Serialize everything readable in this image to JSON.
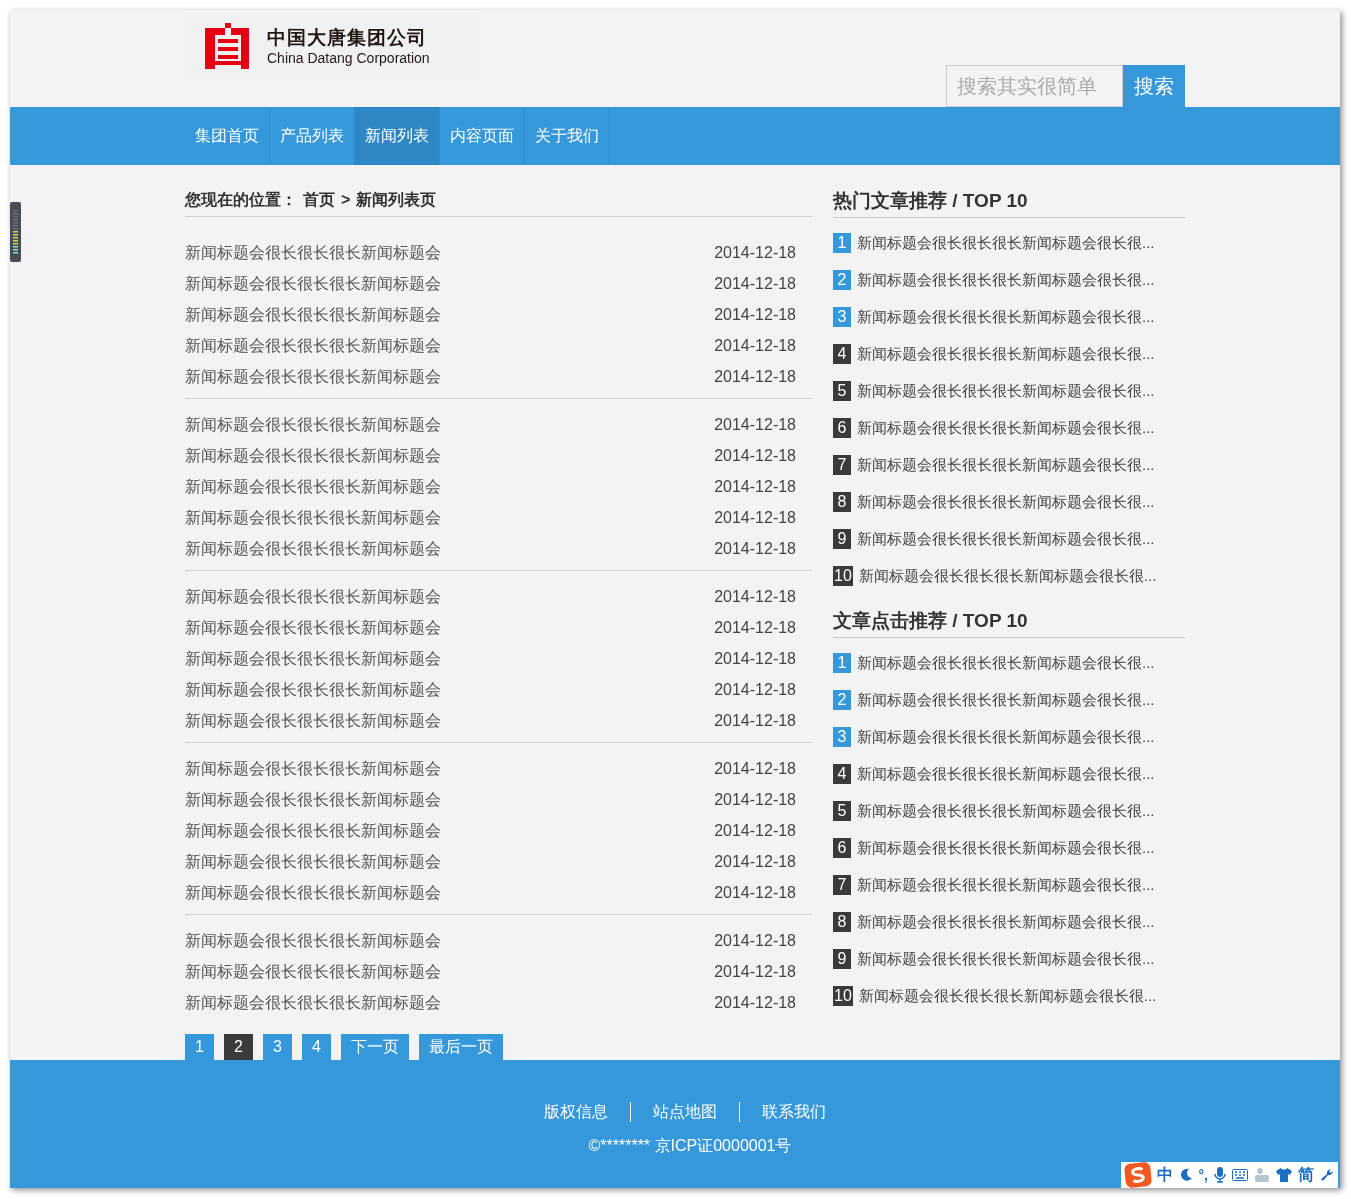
{
  "header": {
    "logo": {
      "name": "中国大唐集团公司",
      "subtitle": "China Datang Corporation"
    },
    "search": {
      "placeholder": "搜索其实很简单",
      "button": "搜索"
    }
  },
  "nav": [
    {
      "label": "集团首页",
      "selected": false
    },
    {
      "label": "产品列表",
      "selected": false
    },
    {
      "label": "新闻列表",
      "selected": true
    },
    {
      "label": "内容页面",
      "selected": false
    },
    {
      "label": "关于我们",
      "selected": false
    }
  ],
  "breadcrumb": {
    "label": "您现在的位置：",
    "items": [
      "首页",
      "新闻列表页"
    ],
    "separator": ">"
  },
  "news_groups": [
    [
      {
        "title": "新闻标题会很长很长很长新闻标题会",
        "date": "2014-12-18"
      },
      {
        "title": "新闻标题会很长很长很长新闻标题会",
        "date": "2014-12-18"
      },
      {
        "title": "新闻标题会很长很长很长新闻标题会",
        "date": "2014-12-18"
      },
      {
        "title": "新闻标题会很长很长很长新闻标题会",
        "date": "2014-12-18"
      },
      {
        "title": "新闻标题会很长很长很长新闻标题会",
        "date": "2014-12-18"
      }
    ],
    [
      {
        "title": "新闻标题会很长很长很长新闻标题会",
        "date": "2014-12-18"
      },
      {
        "title": "新闻标题会很长很长很长新闻标题会",
        "date": "2014-12-18"
      },
      {
        "title": "新闻标题会很长很长很长新闻标题会",
        "date": "2014-12-18"
      },
      {
        "title": "新闻标题会很长很长很长新闻标题会",
        "date": "2014-12-18"
      },
      {
        "title": "新闻标题会很长很长很长新闻标题会",
        "date": "2014-12-18"
      }
    ],
    [
      {
        "title": "新闻标题会很长很长很长新闻标题会",
        "date": "2014-12-18"
      },
      {
        "title": "新闻标题会很长很长很长新闻标题会",
        "date": "2014-12-18"
      },
      {
        "title": "新闻标题会很长很长很长新闻标题会",
        "date": "2014-12-18"
      },
      {
        "title": "新闻标题会很长很长很长新闻标题会",
        "date": "2014-12-18"
      },
      {
        "title": "新闻标题会很长很长很长新闻标题会",
        "date": "2014-12-18"
      }
    ],
    [
      {
        "title": "新闻标题会很长很长很长新闻标题会",
        "date": "2014-12-18"
      },
      {
        "title": "新闻标题会很长很长很长新闻标题会",
        "date": "2014-12-18"
      },
      {
        "title": "新闻标题会很长很长很长新闻标题会",
        "date": "2014-12-18"
      },
      {
        "title": "新闻标题会很长很长很长新闻标题会",
        "date": "2014-12-18"
      },
      {
        "title": "新闻标题会很长很长很长新闻标题会",
        "date": "2014-12-18"
      }
    ],
    [
      {
        "title": "新闻标题会很长很长很长新闻标题会",
        "date": "2014-12-18"
      },
      {
        "title": "新闻标题会很长很长很长新闻标题会",
        "date": "2014-12-18"
      },
      {
        "title": "新闻标题会很长很长很长新闻标题会",
        "date": "2014-12-18"
      }
    ]
  ],
  "pagination": [
    {
      "label": "1",
      "selected": false
    },
    {
      "label": "2",
      "selected": true
    },
    {
      "label": "3",
      "selected": false
    },
    {
      "label": "4",
      "selected": false
    },
    {
      "label": "下一页",
      "selected": false
    },
    {
      "label": "最后一页",
      "selected": false
    }
  ],
  "sidebar": [
    {
      "title": "热门文章推荐 / TOP 10",
      "items": [
        {
          "rank": "1",
          "title": "新闻标题会很长很长很长新闻标题会很长很...",
          "highlighted": true
        },
        {
          "rank": "2",
          "title": "新闻标题会很长很长很长新闻标题会很长很...",
          "highlighted": true
        },
        {
          "rank": "3",
          "title": "新闻标题会很长很长很长新闻标题会很长很...",
          "highlighted": true
        },
        {
          "rank": "4",
          "title": "新闻标题会很长很长很长新闻标题会很长很...",
          "highlighted": false
        },
        {
          "rank": "5",
          "title": "新闻标题会很长很长很长新闻标题会很长很...",
          "highlighted": false
        },
        {
          "rank": "6",
          "title": "新闻标题会很长很长很长新闻标题会很长很...",
          "highlighted": false
        },
        {
          "rank": "7",
          "title": "新闻标题会很长很长很长新闻标题会很长很...",
          "highlighted": false
        },
        {
          "rank": "8",
          "title": "新闻标题会很长很长很长新闻标题会很长很...",
          "highlighted": false
        },
        {
          "rank": "9",
          "title": "新闻标题会很长很长很长新闻标题会很长很...",
          "highlighted": false
        },
        {
          "rank": "10",
          "title": "新闻标题会很长很长很长新闻标题会很长很...",
          "highlighted": false
        }
      ]
    },
    {
      "title": "文章点击推荐 / TOP 10",
      "items": [
        {
          "rank": "1",
          "title": "新闻标题会很长很长很长新闻标题会很长很...",
          "highlighted": true
        },
        {
          "rank": "2",
          "title": "新闻标题会很长很长很长新闻标题会很长很...",
          "highlighted": true
        },
        {
          "rank": "3",
          "title": "新闻标题会很长很长很长新闻标题会很长很...",
          "highlighted": true
        },
        {
          "rank": "4",
          "title": "新闻标题会很长很长很长新闻标题会很长很...",
          "highlighted": false
        },
        {
          "rank": "5",
          "title": "新闻标题会很长很长很长新闻标题会很长很...",
          "highlighted": false
        },
        {
          "rank": "6",
          "title": "新闻标题会很长很长很长新闻标题会很长很...",
          "highlighted": false
        },
        {
          "rank": "7",
          "title": "新闻标题会很长很长很长新闻标题会很长很...",
          "highlighted": false
        },
        {
          "rank": "8",
          "title": "新闻标题会很长很长很长新闻标题会很长很...",
          "highlighted": false
        },
        {
          "rank": "9",
          "title": "新闻标题会很长很长很长新闻标题会很长很...",
          "highlighted": false
        },
        {
          "rank": "10",
          "title": "新闻标题会很长很长很长新闻标题会很长很...",
          "highlighted": false
        }
      ]
    }
  ],
  "footer": {
    "links": [
      "版权信息",
      "站点地图",
      "联系我们"
    ],
    "copyright": "©******** 京ICP证0000001号"
  },
  "ime_toolbar": {
    "mode": "中",
    "script": "简",
    "punctuation": "°,"
  }
}
